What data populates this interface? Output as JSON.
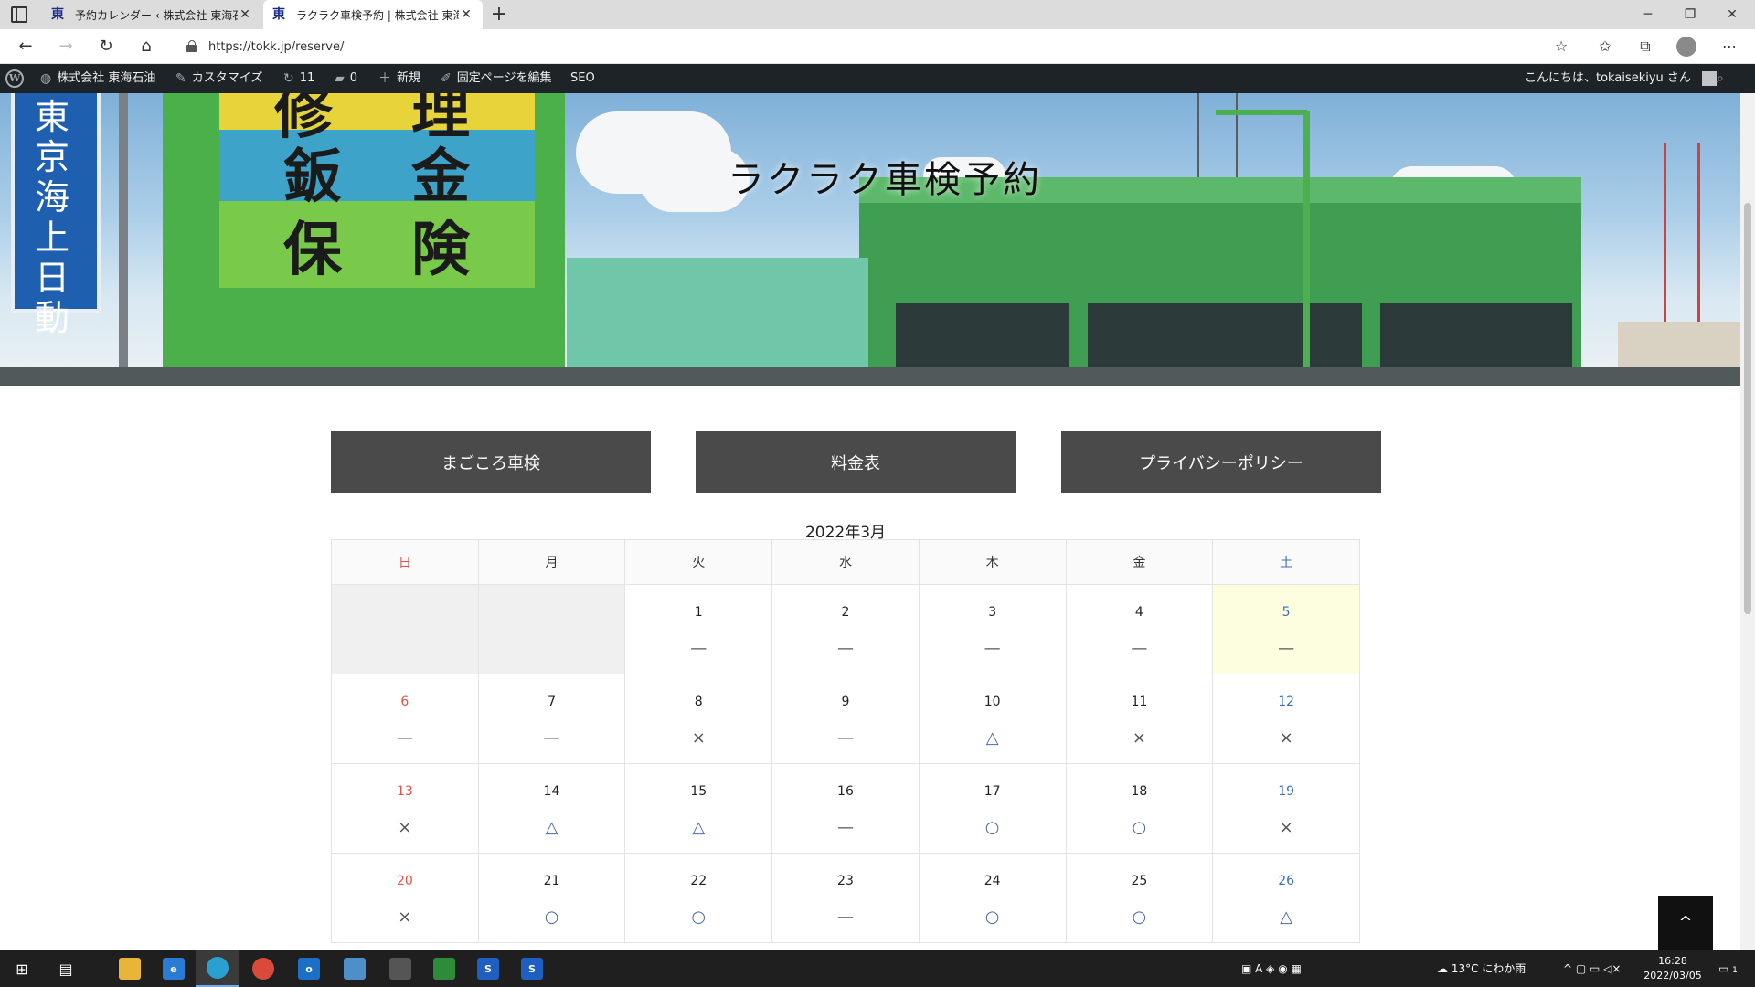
{
  "browser": {
    "tabs": [
      {
        "title": "予約カレンダー ‹ 株式会社 東海石油",
        "favicon": "東"
      },
      {
        "title": "ラクラク車検予約 | 株式会社 東海石",
        "favicon": "東"
      }
    ],
    "url": "https://tokk.jp/reserve/"
  },
  "adminbar": {
    "site_name": "株式会社 東海石油",
    "customize": "カスタマイズ",
    "updates": "11",
    "comments": "0",
    "new": "新規",
    "edit": "固定ページを編集",
    "seo": "SEO",
    "greeting": "こんにちは、tokaisekiyu さん"
  },
  "hero": {
    "title": "ラクラク車検予約",
    "sign_blue": "東京海上日動",
    "sign_chars": [
      "修",
      "理",
      "鈑",
      "金",
      "保",
      "険"
    ]
  },
  "menu": [
    "まごころ車検",
    "料金表",
    "プライバシーポリシー"
  ],
  "calendar": {
    "title": "2022年3月",
    "weekdays": [
      "日",
      "月",
      "火",
      "水",
      "木",
      "金",
      "土"
    ],
    "weeks": [
      [
        {
          "d": "",
          "m": ""
        },
        {
          "d": "",
          "m": ""
        },
        {
          "d": "1",
          "m": "—"
        },
        {
          "d": "2",
          "m": "—"
        },
        {
          "d": "3",
          "m": "—"
        },
        {
          "d": "4",
          "m": "—"
        },
        {
          "d": "5",
          "m": "—"
        }
      ],
      [
        {
          "d": "6",
          "m": "—"
        },
        {
          "d": "7",
          "m": "—"
        },
        {
          "d": "8",
          "m": "×"
        },
        {
          "d": "9",
          "m": "—"
        },
        {
          "d": "10",
          "m": "△"
        },
        {
          "d": "11",
          "m": "×"
        },
        {
          "d": "12",
          "m": "×"
        }
      ],
      [
        {
          "d": "13",
          "m": "×"
        },
        {
          "d": "14",
          "m": "△"
        },
        {
          "d": "15",
          "m": "△"
        },
        {
          "d": "16",
          "m": "—"
        },
        {
          "d": "17",
          "m": "○"
        },
        {
          "d": "18",
          "m": "○"
        },
        {
          "d": "19",
          "m": "×"
        }
      ],
      [
        {
          "d": "20",
          "m": "×"
        },
        {
          "d": "21",
          "m": "○"
        },
        {
          "d": "22",
          "m": "○"
        },
        {
          "d": "23",
          "m": "—"
        },
        {
          "d": "24",
          "m": "○"
        },
        {
          "d": "25",
          "m": "○"
        },
        {
          "d": "26",
          "m": "△"
        }
      ]
    ]
  },
  "to_top": "^",
  "taskbar": {
    "weather": "13°C にわか雨",
    "time": "16:28",
    "date": "2022/03/05",
    "notifications": "1"
  },
  "colors": {
    "sunday": "#e0524a",
    "saturday": "#3a6dbf",
    "button_bg": "#4a4a4a",
    "adminbar_bg": "#1d2327",
    "today_bg": "#fdfde0"
  }
}
